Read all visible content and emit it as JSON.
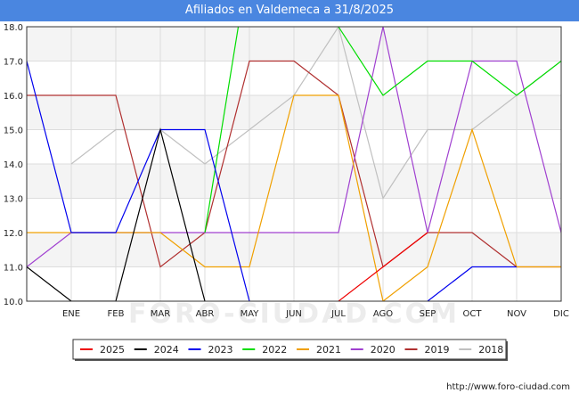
{
  "title": "Afiliados en Valdemeca a 31/8/2025",
  "footer_url": "http://www.foro-ciudad.com",
  "watermark": "FORO-CIUDAD.COM",
  "chart_data": {
    "type": "line",
    "categories": [
      "",
      "ENE",
      "FEB",
      "MAR",
      "ABR",
      "MAY",
      "JUN",
      "JUL",
      "AGO",
      "SEP",
      "OCT",
      "NOV",
      "DIC"
    ],
    "ylim": [
      10.0,
      18.0
    ],
    "yticks": [
      "10.0",
      "11.0",
      "12.0",
      "13.0",
      "14.0",
      "15.0",
      "16.0",
      "17.0",
      "18.0"
    ],
    "grid": true,
    "legend_position": "bottom",
    "series": [
      {
        "name": "2018",
        "color": "#c0c0c0",
        "values": [
          null,
          14,
          15,
          15,
          14,
          15,
          16,
          18,
          13,
          15,
          15,
          16,
          17
        ]
      },
      {
        "name": "2019",
        "color": "#b03030",
        "values": [
          16,
          16,
          16,
          11,
          12,
          17,
          17,
          16,
          11,
          12,
          12,
          11,
          11
        ]
      },
      {
        "name": "2020",
        "color": "#a040d0",
        "values": [
          11,
          12,
          12,
          12,
          12,
          12,
          12,
          12,
          18,
          12,
          17,
          17,
          12
        ]
      },
      {
        "name": "2021",
        "color": "#f0a000",
        "values": [
          12,
          12,
          12,
          12,
          11,
          11,
          16,
          16,
          10,
          11,
          15,
          11,
          11
        ]
      },
      {
        "name": "2022",
        "color": "#00dd00",
        "values": [
          null,
          null,
          null,
          null,
          12,
          20,
          null,
          18,
          16,
          17,
          17,
          16,
          17
        ]
      },
      {
        "name": "2023",
        "color": "#0000ee",
        "values": [
          17,
          12,
          12,
          15,
          15,
          10,
          null,
          null,
          null,
          10,
          11,
          11,
          null
        ]
      },
      {
        "name": "2024",
        "color": "#000000",
        "values": [
          11,
          10,
          10,
          15,
          10,
          null,
          null,
          null,
          null,
          null,
          null,
          null,
          null
        ]
      },
      {
        "name": "2025",
        "color": "#ee0000",
        "values": [
          null,
          null,
          null,
          null,
          null,
          null,
          null,
          10,
          11,
          12,
          null,
          null,
          null
        ]
      }
    ],
    "legend_order": [
      "2025",
      "2024",
      "2023",
      "2022",
      "2021",
      "2020",
      "2019",
      "2018"
    ]
  }
}
